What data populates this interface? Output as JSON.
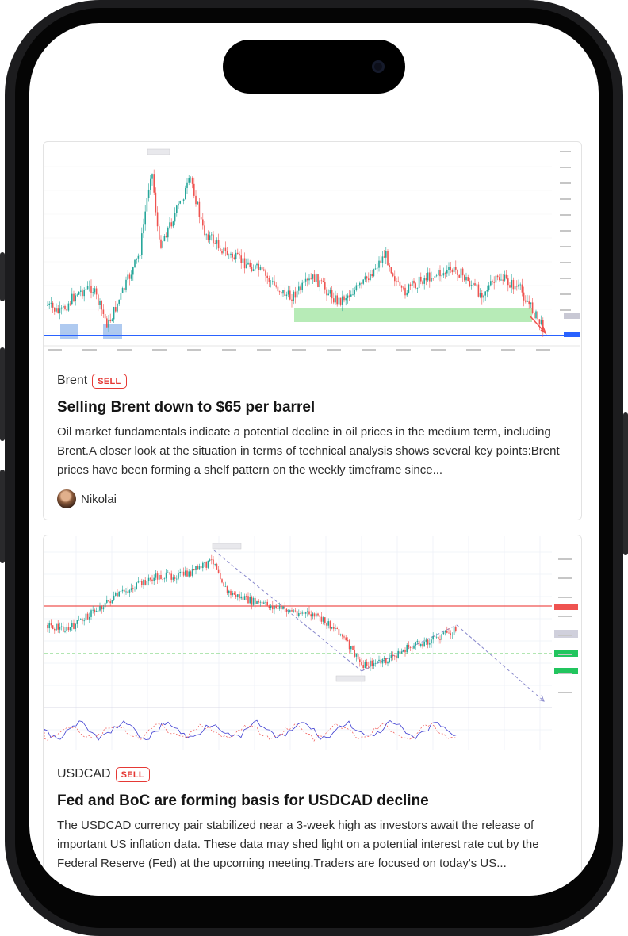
{
  "feed": {
    "posts": [
      {
        "ticker": "Brent",
        "signal": "SELL",
        "title": "Selling Brent down to $65 per barrel",
        "description": "Oil market fundamentals indicate a potential decline in oil prices in the medium term, including Brent.A closer look at the situation in terms of technical analysis shows several key points:Brent prices have been forming a shelf pattern on the weekly timeframe since...",
        "author": "Nikolai"
      },
      {
        "ticker": "USDCAD",
        "signal": "SELL",
        "title": "Fed and BoC are forming basis for USDCAD decline",
        "description": "The USDCAD currency pair stabilized near a 3-week high as investors await the release of important US inflation data. These data may shed light on a potential interest rate cut by the Federal Reserve (Fed) at the upcoming meeting.Traders are focused on today's US...",
        "author": ""
      }
    ]
  },
  "colors": {
    "accent_sell": "#e53935",
    "candle_up": "#26a69a",
    "candle_down": "#ef5350",
    "support_zone": "#a5e6a5",
    "support_line": "#2962ff"
  },
  "icons": {
    "avatar": "user-avatar"
  }
}
